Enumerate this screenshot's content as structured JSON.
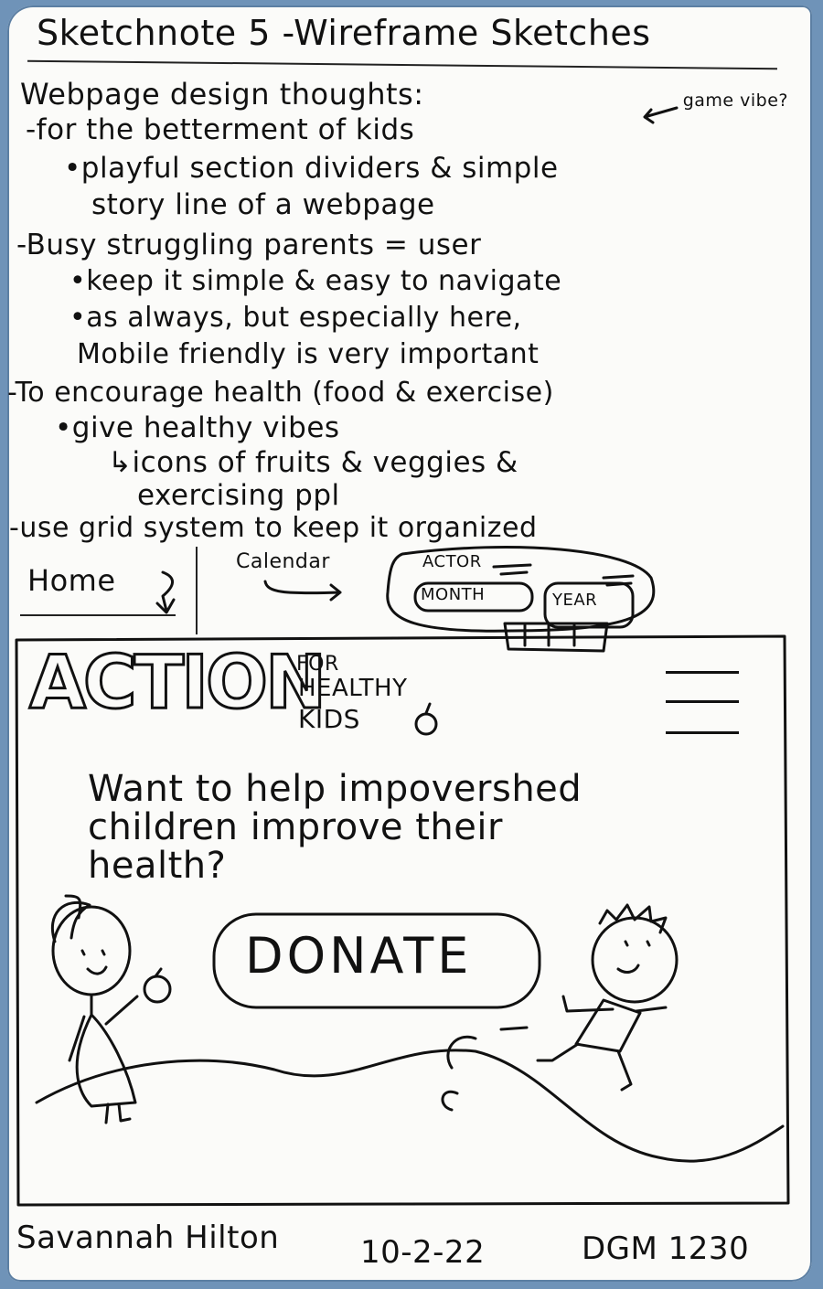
{
  "title": "Sketchnote 5 -Wireframe Sketches",
  "notes": {
    "heading": "Webpage design thoughts:",
    "kids": "-for the betterment of kids",
    "game_vibe": "game vibe?",
    "playful": "•playful section dividers & simple",
    "storyline": "story line of a webpage",
    "parents": "-Busy struggling parents = user",
    "simple": "•keep it simple & easy to navigate",
    "always": "•as always, but especially here,",
    "mobile": "Mobile friendly is very important",
    "health": "-To encourage health (food & exercise)",
    "vibes": "•give healthy vibes",
    "icons": "↳icons of fruits & veggies &",
    "exercising": "exercising ppl",
    "grid": "-use grid system to keep it organized"
  },
  "calendar_sketch": {
    "home_label": "Home",
    "calendar_label": "Calendar",
    "widget_title": "ACTOR",
    "month": "MONTH",
    "year": "YEAR"
  },
  "wireframe": {
    "logo_main": "ACTION",
    "logo_for": "FOR",
    "logo_healthy": "HEALTHY",
    "logo_kids": "KIDS",
    "headline_1": "Want to help impovershed",
    "headline_2": "children improve their",
    "headline_3": "health?",
    "donate": "DONATE"
  },
  "signature": {
    "name": "Savannah Hilton",
    "date": "10-2-22",
    "course": "DGM 1230"
  }
}
